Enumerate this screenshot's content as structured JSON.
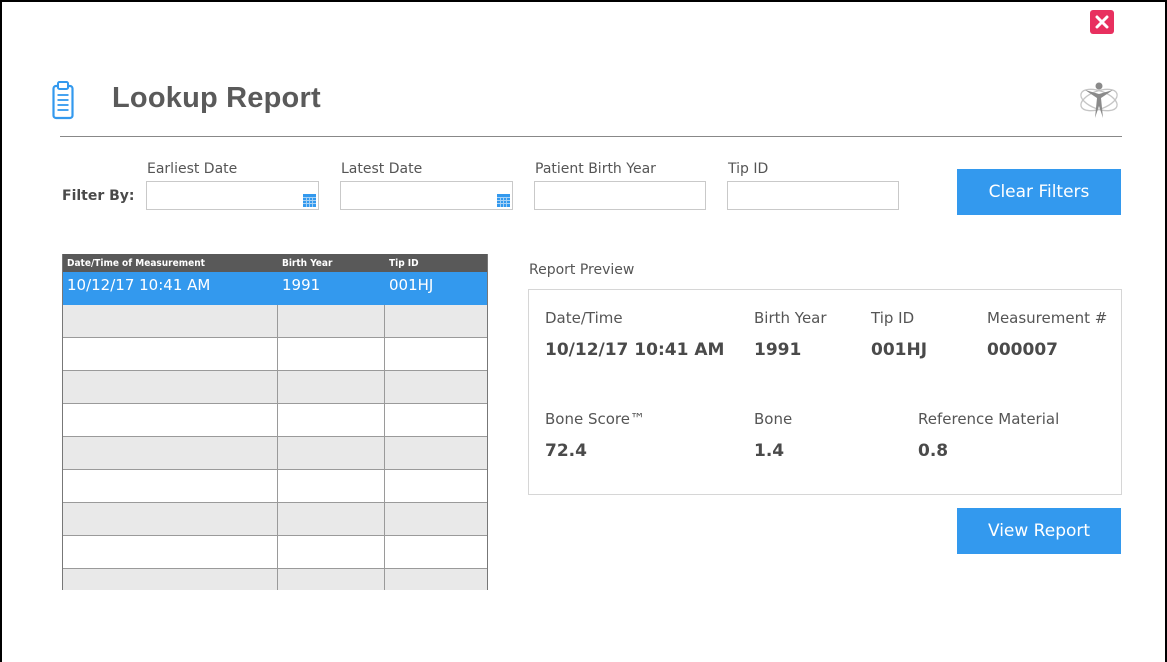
{
  "header": {
    "title": "Lookup Report"
  },
  "filters": {
    "label": "Filter By:",
    "earliest_date_label": "Earliest Date",
    "earliest_date_value": "",
    "latest_date_label": "Latest Date",
    "latest_date_value": "",
    "birth_year_label": "Patient Birth Year",
    "birth_year_value": "",
    "tip_id_label": "Tip ID",
    "tip_id_value": "",
    "clear_button": "Clear Filters"
  },
  "table": {
    "columns": [
      "Date/Time of Measurement",
      "Birth Year",
      "Tip ID"
    ],
    "rows": [
      [
        "10/12/17 10:41 AM",
        "1991",
        "001HJ"
      ],
      [
        "",
        "",
        ""
      ],
      [
        "",
        "",
        ""
      ],
      [
        "",
        "",
        ""
      ],
      [
        "",
        "",
        ""
      ],
      [
        "",
        "",
        ""
      ],
      [
        "",
        "",
        ""
      ],
      [
        "",
        "",
        ""
      ],
      [
        "",
        "",
        ""
      ],
      [
        "",
        "",
        ""
      ]
    ],
    "selected_row": 0
  },
  "preview": {
    "title": "Report Preview",
    "datetime_label": "Date/Time",
    "datetime_value": "10/12/17 10:41 AM",
    "birth_year_label": "Birth Year",
    "birth_year_value": "1991",
    "tip_id_label": "Tip ID",
    "tip_id_value": "001HJ",
    "measurement_label": "Measurement #",
    "measurement_value": "000007",
    "bone_score_label": "Bone Score™",
    "bone_score_value": "72.4",
    "bone_label": "Bone",
    "bone_value": "1.4",
    "reference_label": "Reference Material",
    "reference_value": "0.8",
    "view_button": "View Report"
  },
  "colors": {
    "accent": "#3399ee",
    "close": "#e8305f",
    "header_bg": "#595959",
    "row_alt": "#e9e9e9"
  },
  "icons": {
    "close": "close-icon",
    "title": "clipboard-icon",
    "logo": "figure-logo-icon",
    "calendar": "calendar-icon"
  }
}
